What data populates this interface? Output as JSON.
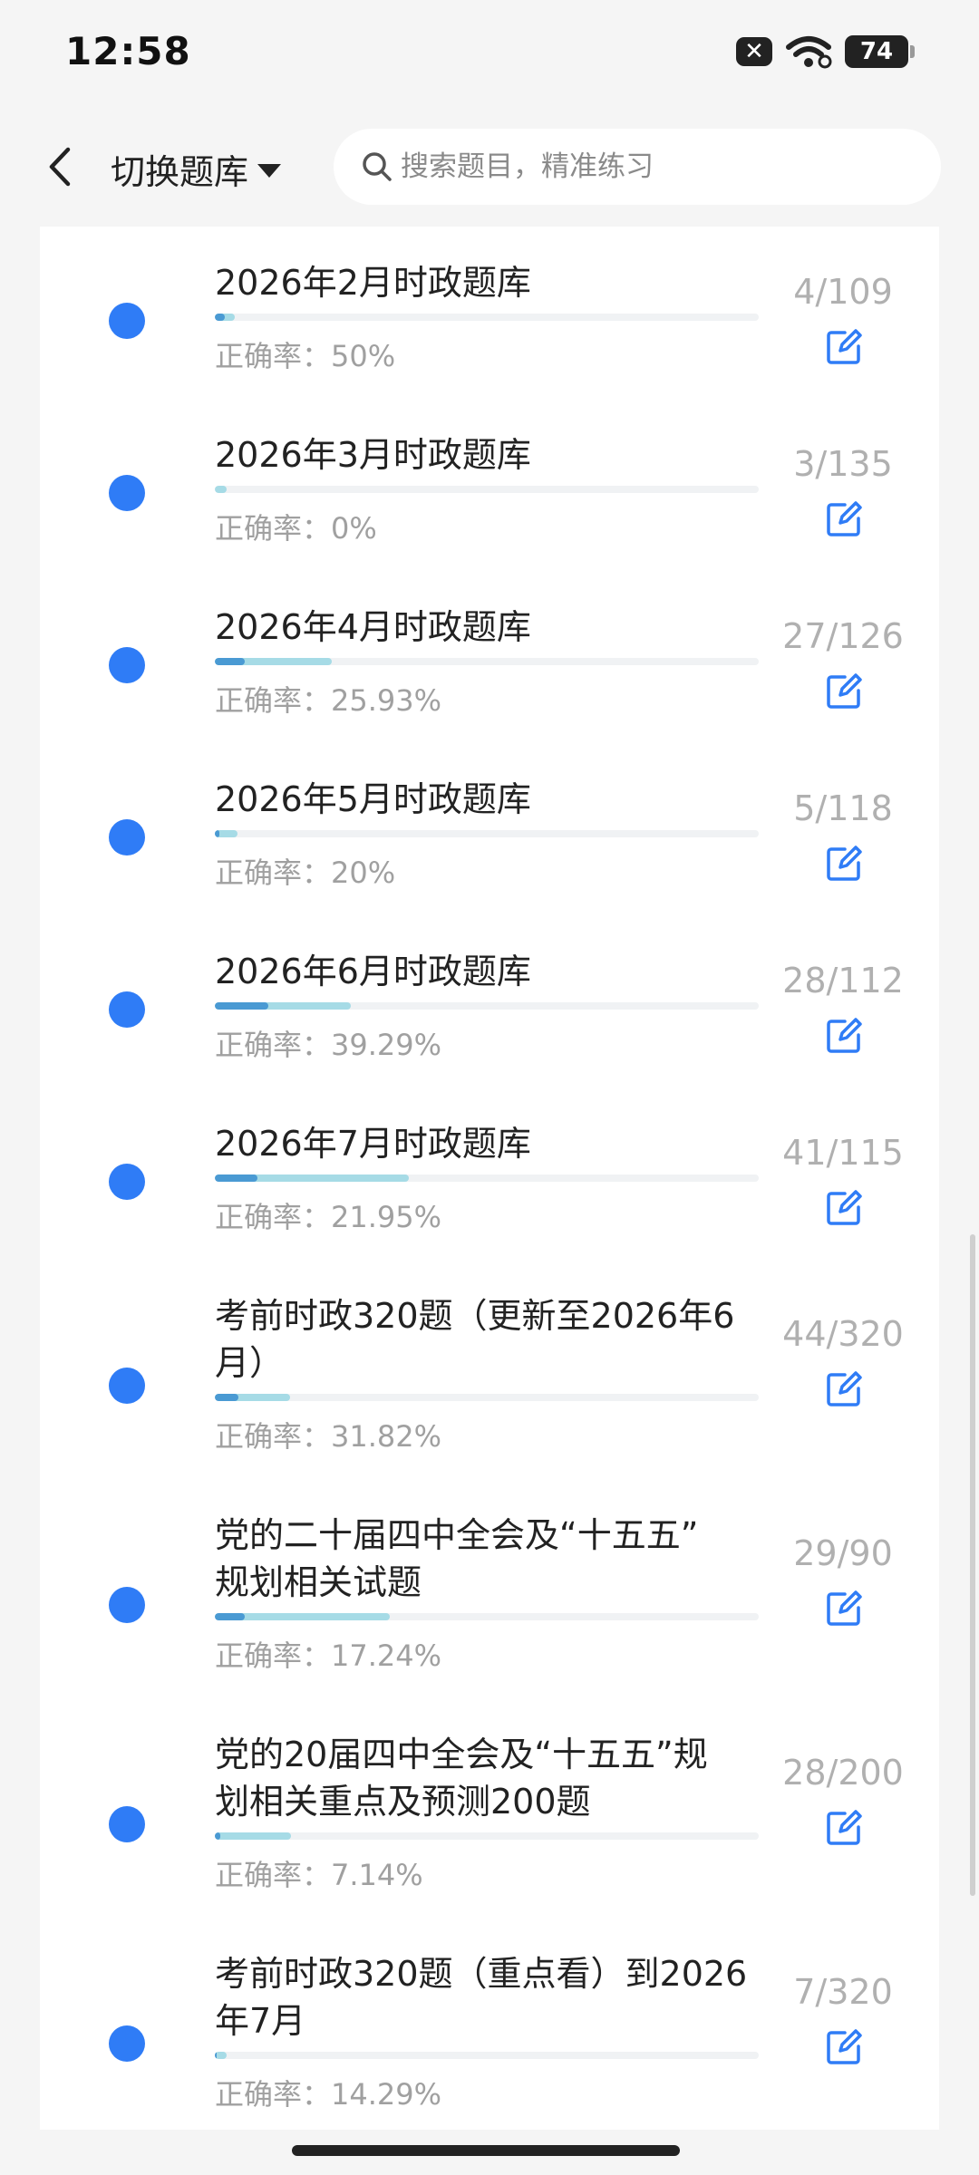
{
  "status": {
    "time": "12:58",
    "battery": "74",
    "sim_symbol": "✕"
  },
  "header": {
    "switch_label": "切换题库",
    "search_placeholder": "搜索题目，精准练习"
  },
  "accuracy_prefix": "正确率：",
  "items": [
    {
      "title": "2026年2月时政题库",
      "count": "4/109",
      "accuracy": "50%",
      "done": 4,
      "total": 109,
      "correct_fraction": 0.5
    },
    {
      "title": "2026年3月时政题库",
      "count": "3/135",
      "accuracy": "0%",
      "done": 3,
      "total": 135,
      "correct_fraction": 0
    },
    {
      "title": "2026年4月时政题库",
      "count": "27/126",
      "accuracy": "25.93%",
      "done": 27,
      "total": 126,
      "correct_fraction": 0.2593
    },
    {
      "title": "2026年5月时政题库",
      "count": "5/118",
      "accuracy": "20%",
      "done": 5,
      "total": 118,
      "correct_fraction": 0.2
    },
    {
      "title": "2026年6月时政题库",
      "count": "28/112",
      "accuracy": "39.29%",
      "done": 28,
      "total": 112,
      "correct_fraction": 0.3929
    },
    {
      "title": "2026年7月时政题库",
      "count": "41/115",
      "accuracy": "21.95%",
      "done": 41,
      "total": 115,
      "correct_fraction": 0.2195
    },
    {
      "title_lines": [
        "考前时政320题（更新至2026年6",
        "月）"
      ],
      "count": "44/320",
      "accuracy": "31.82%",
      "done": 44,
      "total": 320,
      "correct_fraction": 0.3182
    },
    {
      "title_lines": [
        "党的二十届四中全会及“十五五”",
        "规划相关试题"
      ],
      "count": "29/90",
      "accuracy": "17.24%",
      "done": 29,
      "total": 90,
      "correct_fraction": 0.1724
    },
    {
      "title_lines": [
        "党的20届四中全会及“十五五”规",
        "划相关重点及预测200题"
      ],
      "count": "28/200",
      "accuracy": "7.14%",
      "done": 28,
      "total": 200,
      "correct_fraction": 0.0714
    },
    {
      "title_lines": [
        "考前时政320题（重点看）到2026",
        "年7月"
      ],
      "count": "7/320",
      "accuracy": "14.29%",
      "done": 7,
      "total": 320,
      "correct_fraction": 0.1429
    }
  ],
  "colors": {
    "dot": "#2f7cf6",
    "progress_done": "#a6dbe6",
    "progress_correct": "#4a9ad3"
  }
}
